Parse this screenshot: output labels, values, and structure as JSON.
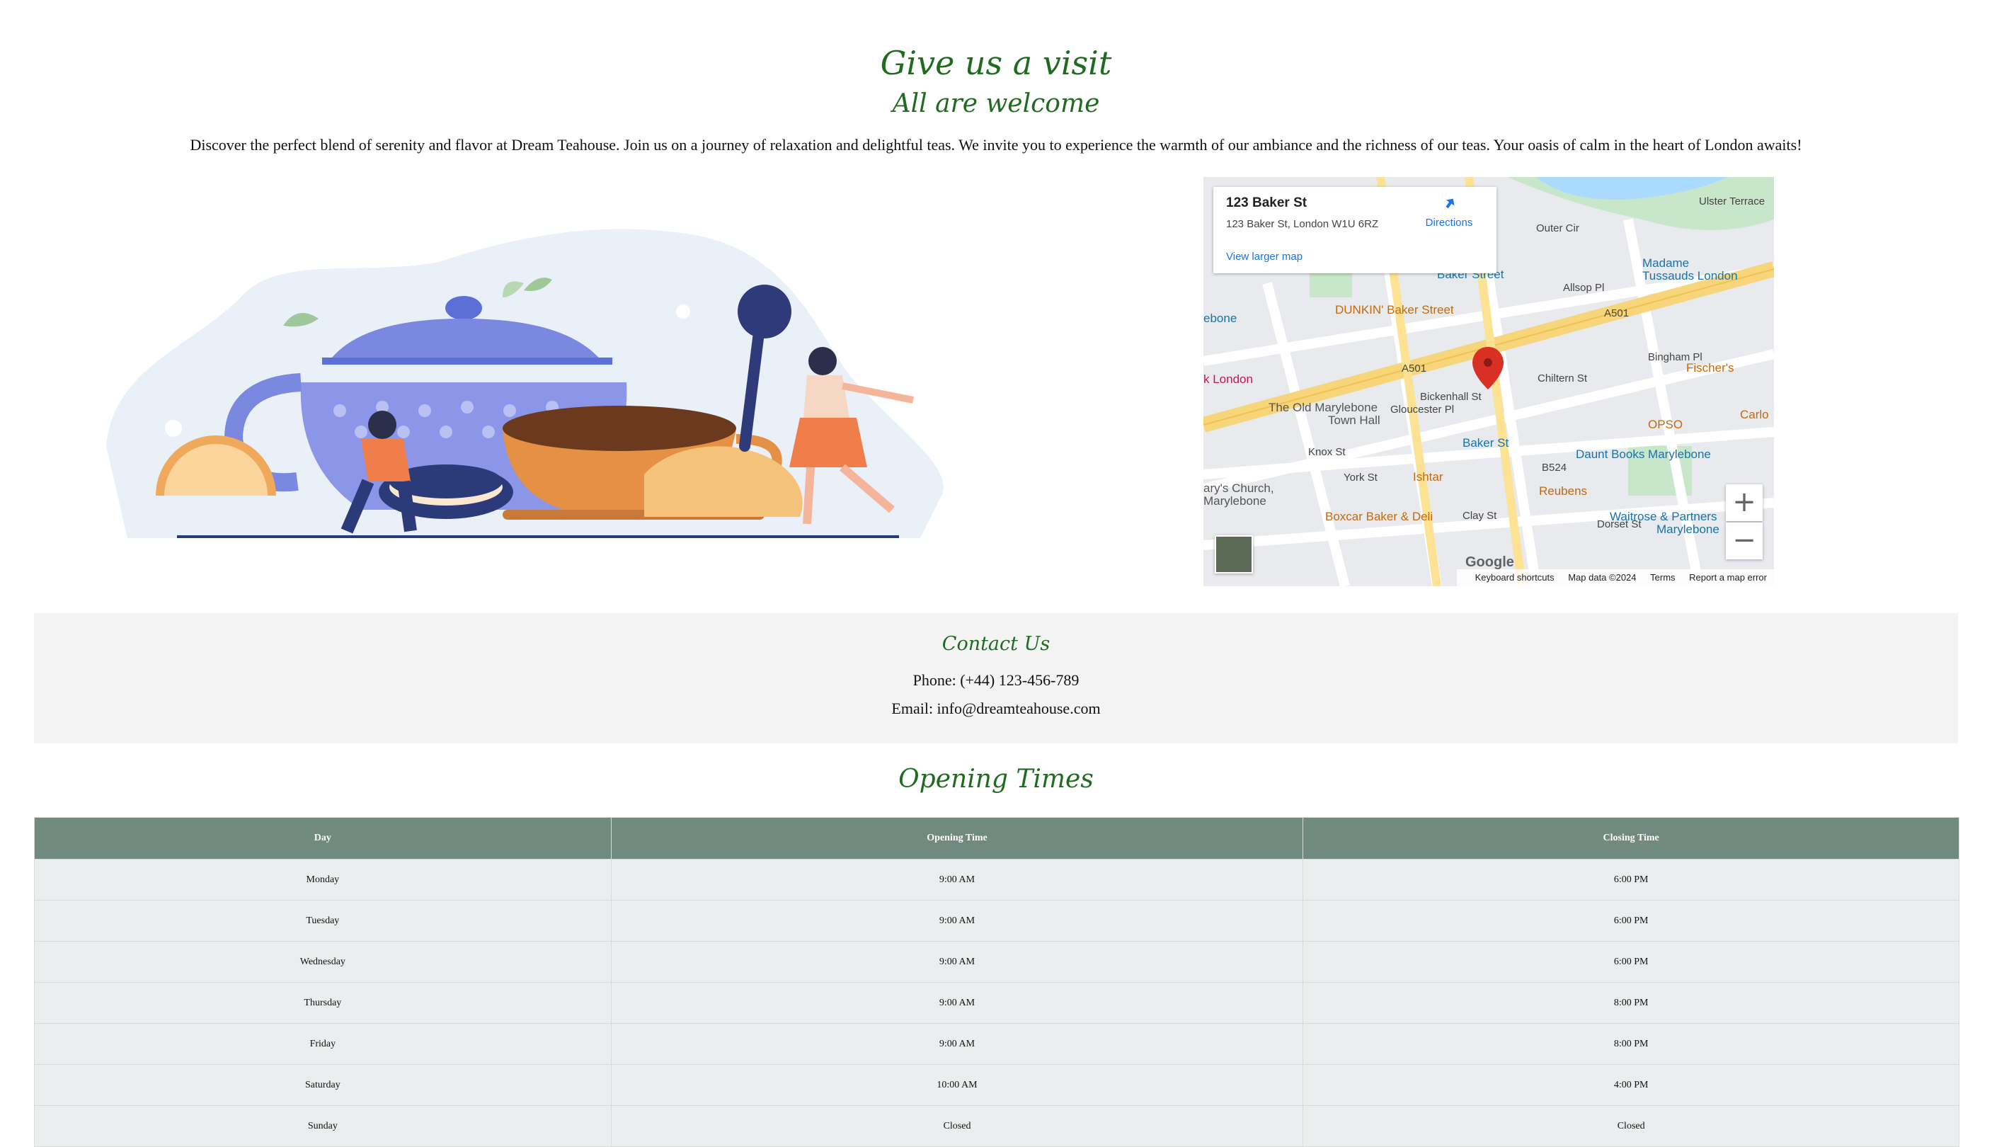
{
  "header": {
    "title": "Give us a visit",
    "subtitle": "All are welcome",
    "intro": "Discover the perfect blend of serenity and flavor at Dream Teahouse. Join us on a journey of relaxation and delightful teas. We invite you to experience the warmth of our ambiance and the richness of our teas. Your oasis of calm in the heart of London awaits!"
  },
  "map": {
    "place_name": "123 Baker St",
    "address": "123 Baker St, London W1U 6RZ",
    "directions_label": "Directions",
    "view_larger": "View larger map",
    "zoom_in": "+",
    "zoom_out": "−",
    "google_logo": "Google",
    "attribution": {
      "shortcuts": "Keyboard shortcuts",
      "data": "Map data ©2024",
      "terms": "Terms",
      "report": "Report a map error"
    },
    "labels": {
      "madame": "Madame",
      "madame2": "Tussauds London",
      "dunkin": "DUNKIN' Baker Street",
      "baker_street": "Baker Street",
      "old_marylebone": "The Old Marylebone",
      "town_hall": "Town Hall",
      "baker_st": "Baker St",
      "daunt": "Daunt Books Marylebone",
      "fischers": "Fischer's",
      "opso": "OPSO",
      "carlo": "Carlo",
      "ishtar": "Ishtar",
      "reubens": "Reubens",
      "boxcar": "Boxcar Baker & Deli",
      "waitrose": "Waitrose & Partners",
      "waitrose2": "Marylebone",
      "church": "ary's Church,",
      "church2": "Marylebone",
      "london_left": "k London",
      "ebone": "ebone",
      "a501a": "A501",
      "a501b": "A501",
      "b524": "B524",
      "outer_cir": "Outer Cir",
      "ulster": "Ulster Terrace",
      "allsop": "Allsop Pl",
      "chiltern": "Chiltern St",
      "bingham": "Bingham Pl",
      "gloucester": "Gloucester Pl",
      "bickenhall": "Bickenhall St",
      "knox": "Knox St",
      "york": "York St",
      "clay": "Clay St",
      "dorset": "Dorset St"
    },
    "colors": {
      "land": "#eceff1",
      "major_road": "#f7d57a",
      "park": "#c8e6c9",
      "water": "#aadaff",
      "pin": "#d93025"
    }
  },
  "contact": {
    "title": "Contact Us",
    "phone": "Phone: (+44) 123-456-789",
    "email": "Email: info@dreamteahouse.com"
  },
  "hours": {
    "title": "Opening Times",
    "columns": [
      "Day",
      "Opening Time",
      "Closing Time"
    ],
    "rows": [
      [
        "Monday",
        "9:00 AM",
        "6:00 PM"
      ],
      [
        "Tuesday",
        "9:00 AM",
        "6:00 PM"
      ],
      [
        "Wednesday",
        "9:00 AM",
        "6:00 PM"
      ],
      [
        "Thursday",
        "9:00 AM",
        "8:00 PM"
      ],
      [
        "Friday",
        "9:00 AM",
        "8:00 PM"
      ],
      [
        "Saturday",
        "10:00 AM",
        "4:00 PM"
      ],
      [
        "Sunday",
        "Closed",
        "Closed"
      ]
    ]
  }
}
